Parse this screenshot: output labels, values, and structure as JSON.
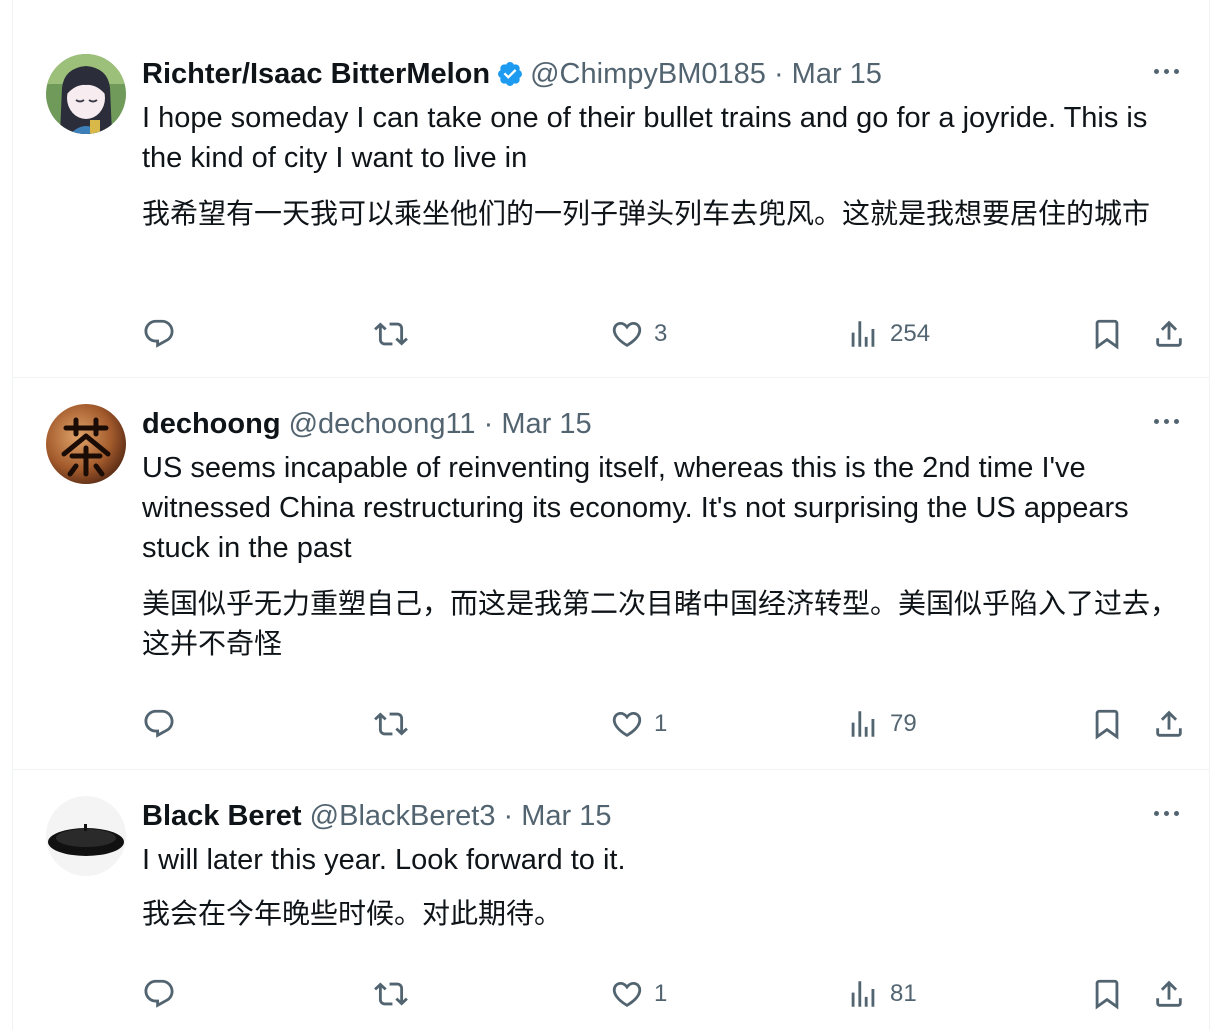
{
  "tweets": [
    {
      "name": "Richter/Isaac BitterMelon",
      "verified": true,
      "handle": "@ChimpyBM0185",
      "separator": "·",
      "date": "Mar 15",
      "text_en": "I hope someday I can take one of their bullet trains and go for a joyride. This is the kind of city I want to live in",
      "text_zh": "我希望有一天我可以乘坐他们的一列子弹头列车去兜风。这就是我想要居住的城市",
      "reply_count": "",
      "retweet_count": "",
      "like_count": "3",
      "view_count": "254"
    },
    {
      "name": "dechoong",
      "verified": false,
      "handle": "@dechoong11",
      "separator": "·",
      "date": "Mar 15",
      "text_en": "US seems incapable of reinventing itself, whereas this is the 2nd time I've witnessed China restructuring its economy. It's not surprising the US appears stuck in the past",
      "text_zh": "美国似乎无力重塑自己，而这是我第二次目睹中国经济转型。美国似乎陷入了过去，这并不奇怪",
      "reply_count": "",
      "retweet_count": "",
      "like_count": "1",
      "view_count": "79"
    },
    {
      "name": "Black Beret",
      "verified": false,
      "handle": "@BlackBeret3",
      "separator": "·",
      "date": "Mar 15",
      "text_en": "I will later this year. Look forward to it.",
      "text_zh": "我会在今年晚些时候。对此期待。",
      "reply_count": "",
      "retweet_count": "",
      "like_count": "1",
      "view_count": "81"
    }
  ],
  "colors": {
    "text": "#0f1419",
    "secondary": "#536471",
    "verified": "#1d9bf0",
    "divider": "#eff3f4"
  },
  "icons": [
    "verified-badge-icon",
    "more-icon",
    "reply-icon",
    "retweet-icon",
    "like-icon",
    "views-icon",
    "bookmark-icon",
    "share-icon"
  ]
}
